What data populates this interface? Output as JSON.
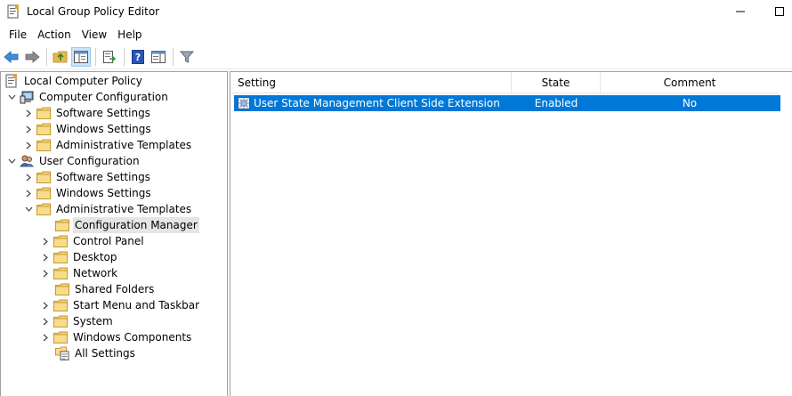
{
  "window": {
    "title": "Local Group Policy Editor"
  },
  "menu": [
    "File",
    "Action",
    "View",
    "Help"
  ],
  "toolbar": {
    "buttons": [
      "back-icon",
      "forward-icon",
      "up-folder-icon",
      "show-hide-tree-icon",
      "export-list-icon",
      "help-icon",
      "properties-pane-icon",
      "filter-icon"
    ]
  },
  "tree": {
    "root": "Local Computer Policy",
    "computer_config": "Computer Configuration",
    "cc_software": "Software Settings",
    "cc_windows": "Windows Settings",
    "cc_admin": "Administrative Templates",
    "user_config": "User Configuration",
    "uc_software": "Software Settings",
    "uc_windows": "Windows Settings",
    "uc_admin": "Administrative Templates",
    "config_manager": "Configuration Manager",
    "control_panel": "Control Panel",
    "desktop": "Desktop",
    "network": "Network",
    "shared_folders": "Shared Folders",
    "start_menu": "Start Menu and Taskbar",
    "system": "System",
    "windows_components": "Windows Components",
    "all_settings": "All Settings"
  },
  "details": {
    "headers": {
      "setting": "Setting",
      "state": "State",
      "comment": "Comment"
    },
    "rows": [
      {
        "setting": "User State Management Client Side Extension",
        "state": "Enabled",
        "comment": "No"
      }
    ]
  },
  "colors": {
    "selection": "#0078d7",
    "folder": "#e8b84a"
  }
}
